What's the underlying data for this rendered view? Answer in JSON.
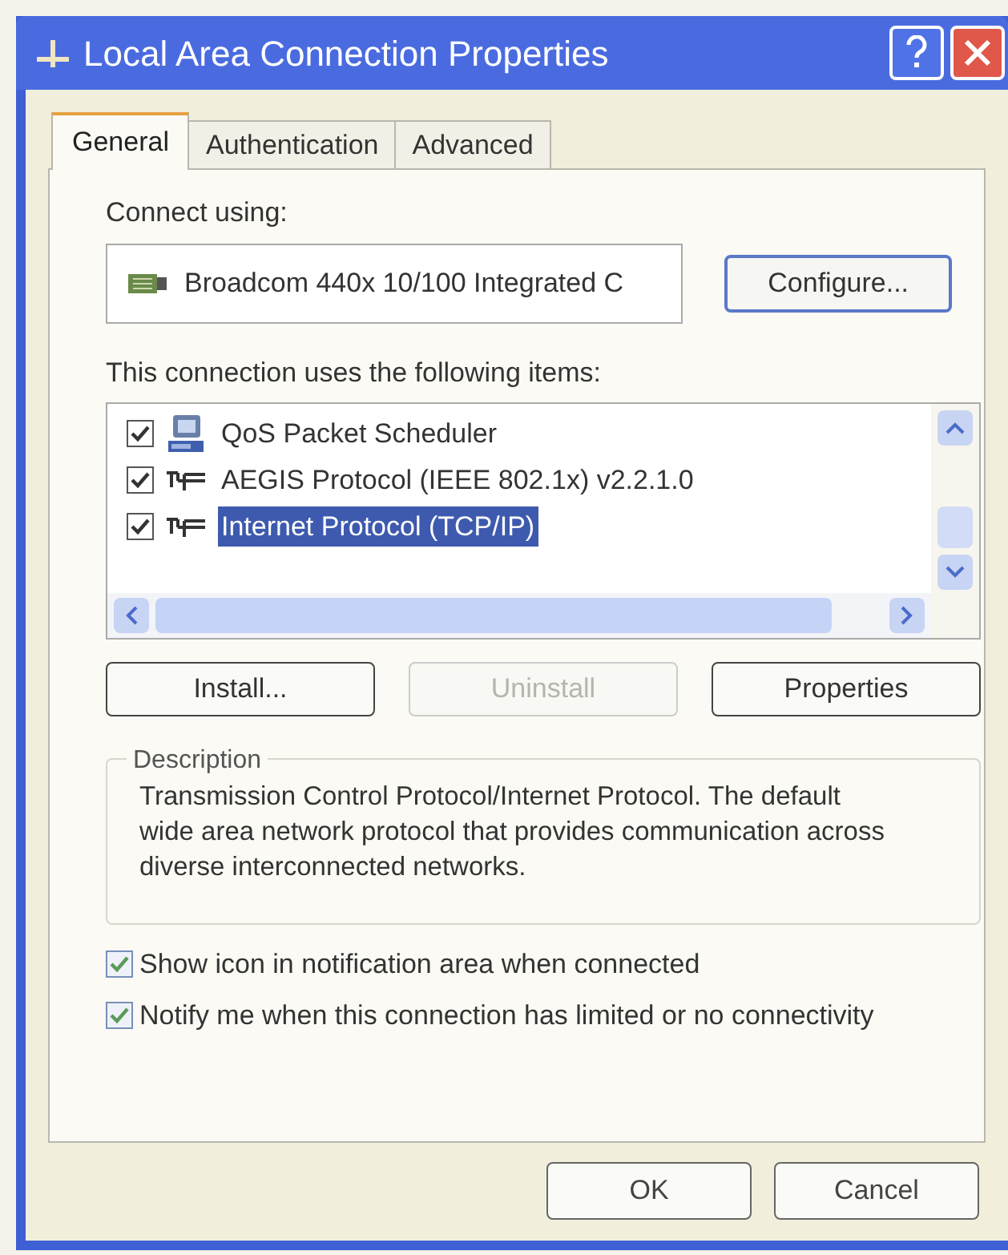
{
  "window": {
    "title": "Local Area Connection Properties"
  },
  "tabs": [
    {
      "label": "General",
      "selected": true
    },
    {
      "label": "Authentication",
      "selected": false
    },
    {
      "label": "Advanced",
      "selected": false
    }
  ],
  "connect_using": {
    "label": "Connect using:",
    "adapter": "Broadcom 440x 10/100 Integrated C",
    "button": "Configure..."
  },
  "items_label": "This connection uses the following items:",
  "items": [
    {
      "label": "QoS Packet Scheduler",
      "kind": "service",
      "checked": true,
      "selected": false
    },
    {
      "label": "AEGIS Protocol (IEEE 802.1x) v2.2.1.0",
      "kind": "protocol",
      "checked": true,
      "selected": false
    },
    {
      "label": "Internet Protocol (TCP/IP)",
      "kind": "protocol",
      "checked": true,
      "selected": true
    }
  ],
  "item_buttons": [
    {
      "label": "Install...",
      "disabled": false
    },
    {
      "label": "Uninstall",
      "disabled": true
    },
    {
      "label": "Properties",
      "disabled": false
    }
  ],
  "description": {
    "title": "Description",
    "text": "Transmission Control Protocol/Internet Protocol. The default wide area network protocol that provides communication across diverse interconnected networks."
  },
  "options": [
    {
      "label": "Show icon in notification area when connected",
      "checked": true
    },
    {
      "label": "Notify me when this connection has limited or no connectivity",
      "checked": true
    }
  ],
  "buttons": [
    "OK",
    "Cancel"
  ]
}
